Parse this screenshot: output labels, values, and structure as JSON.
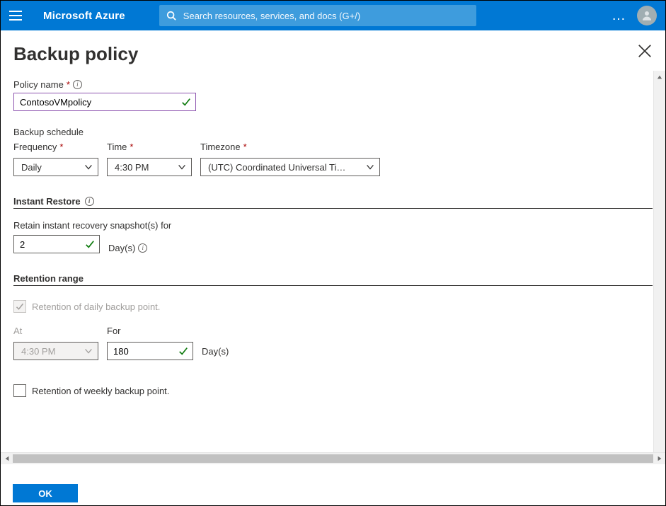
{
  "header": {
    "brand": "Microsoft Azure",
    "search_placeholder": "Search resources, services, and docs (G+/)"
  },
  "page": {
    "title": "Backup policy"
  },
  "form": {
    "policy_name_label": "Policy name",
    "policy_name_value": "ContosoVMpolicy",
    "schedule_header": "Backup schedule",
    "frequency_label": "Frequency",
    "frequency_value": "Daily",
    "time_label": "Time",
    "time_value": "4:30 PM",
    "timezone_label": "Timezone",
    "timezone_value": "(UTC) Coordinated Universal Ti…",
    "instant_restore_header": "Instant Restore",
    "instant_retain_label": "Retain instant recovery snapshot(s) for",
    "instant_retain_value": "2",
    "instant_retain_unit": "Day(s)",
    "retention_header": "Retention range",
    "daily_retention_label": "Retention of daily backup point.",
    "at_label": "At",
    "at_value": "4:30 PM",
    "for_label": "For",
    "for_value": "180",
    "for_unit": "Day(s)",
    "weekly_retention_label": "Retention of weekly backup point."
  },
  "footer": {
    "ok_label": "OK"
  }
}
